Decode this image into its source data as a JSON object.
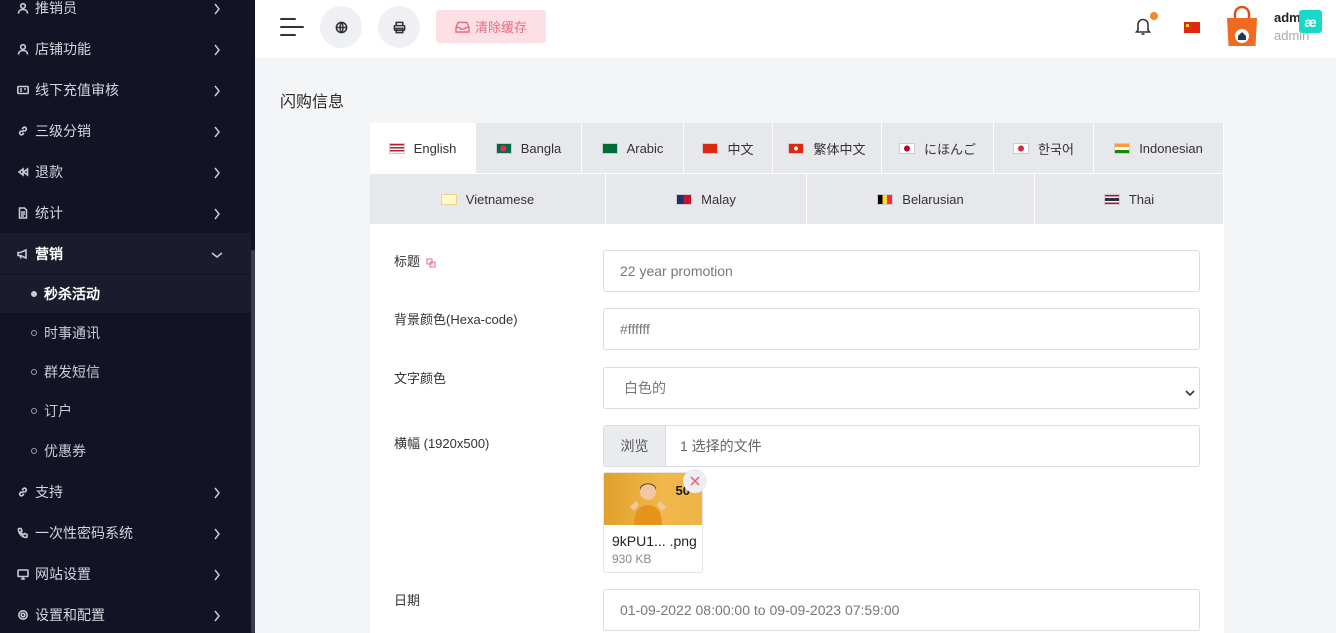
{
  "sidebar": {
    "items": [
      {
        "label": "推销员",
        "icon": "person-icon"
      },
      {
        "label": "店铺功能",
        "icon": "person-icon"
      },
      {
        "label": "线下充值审核",
        "icon": "card-icon"
      },
      {
        "label": "三级分销",
        "icon": "link-icon"
      },
      {
        "label": "退款",
        "icon": "rewind-icon"
      },
      {
        "label": "统计",
        "icon": "document-icon"
      },
      {
        "label": "营销",
        "icon": "megaphone-icon"
      }
    ],
    "marketing_sub": [
      {
        "label": "秒杀活动"
      },
      {
        "label": "时事通讯"
      },
      {
        "label": "群发短信"
      },
      {
        "label": "订户"
      },
      {
        "label": "优惠券"
      }
    ],
    "bottom_items": [
      {
        "label": "支持",
        "icon": "link-icon"
      },
      {
        "label": "一次性密码系统",
        "icon": "phone-icon"
      },
      {
        "label": "网站设置",
        "icon": "monitor-icon"
      },
      {
        "label": "设置和配置",
        "icon": "gear-icon"
      }
    ]
  },
  "topbar": {
    "clear_cache_label": "清除缓存",
    "user_name": "admin",
    "user_role": "admin",
    "ae_badge": "æ",
    "badge_color": "#f28a22"
  },
  "page": {
    "title": "闪购信息"
  },
  "tabs": {
    "row1": [
      {
        "label": "English",
        "flag": "us"
      },
      {
        "label": "Bangla",
        "flag": "bd"
      },
      {
        "label": "Arabic",
        "flag": "sa"
      },
      {
        "label": "中文",
        "flag": "cn"
      },
      {
        "label": "繁体中文",
        "flag": "hk"
      },
      {
        "label": "にほんご",
        "flag": "jp"
      },
      {
        "label": "한국어",
        "flag": "kr"
      },
      {
        "label": "Indonesian",
        "flag": "in"
      }
    ],
    "row2": [
      {
        "label": "Vietnamese",
        "flag": "vn"
      },
      {
        "label": "Malay",
        "flag": "my"
      },
      {
        "label": "Belarusian",
        "flag": "be"
      },
      {
        "label": "Thai",
        "flag": "th"
      }
    ]
  },
  "form": {
    "title_label": "标题",
    "title_value": "22 year promotion",
    "bg_label": "背景颜色(Hexa-code)",
    "bg_value": "#ffffff",
    "text_color_label": "文字颜色",
    "text_color_value": "白色的",
    "banner_label": "横幅 (1920x500)",
    "browse_label": "浏览",
    "file_text": "1 选择的文件",
    "file_name": "9kPU1...  .png",
    "file_size": "930 KB",
    "thumb_text": "50",
    "date_label": "日期",
    "date_value": "01-09-2022 08:00:00 to 09-09-2023 07:59:00"
  }
}
